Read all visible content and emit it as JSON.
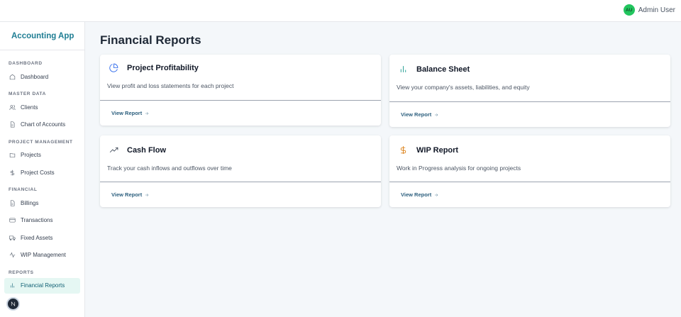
{
  "topbar": {
    "user_initials": "AU",
    "user_name": "Admin User"
  },
  "sidebar": {
    "brand": "Accounting App",
    "sections": [
      {
        "title": "DASHBOARD",
        "items": [
          {
            "label": "Dashboard",
            "icon": "home-icon"
          }
        ]
      },
      {
        "title": "MASTER DATA",
        "items": [
          {
            "label": "Clients",
            "icon": "users-icon"
          },
          {
            "label": "Chart of Accounts",
            "icon": "file-icon"
          }
        ]
      },
      {
        "title": "PROJECT MANAGEMENT",
        "items": [
          {
            "label": "Projects",
            "icon": "folder-icon"
          },
          {
            "label": "Project Costs",
            "icon": "dollar-icon"
          }
        ]
      },
      {
        "title": "FINANCIAL",
        "items": [
          {
            "label": "Billings",
            "icon": "file-icon"
          },
          {
            "label": "Transactions",
            "icon": "credit-card-icon"
          },
          {
            "label": "Fixed Assets",
            "icon": "truck-icon"
          },
          {
            "label": "WIP Management",
            "icon": "activity-icon"
          }
        ]
      },
      {
        "title": "REPORTS",
        "items": [
          {
            "label": "Financial Reports",
            "icon": "bar-chart-icon",
            "active": true
          }
        ]
      }
    ]
  },
  "main": {
    "title": "Financial Reports",
    "cards": [
      {
        "title": "Project Profitability",
        "description": "View profit and loss statements for each project",
        "link": "View Report",
        "icon": "pie-chart-icon",
        "icon_color": "#2563eb"
      },
      {
        "title": "Balance Sheet",
        "description": "View your company's assets, liabilities, and equity",
        "link": "View Report",
        "icon": "bar-chart-icon",
        "icon_color": "#0d9488"
      },
      {
        "title": "Cash Flow",
        "description": "Track your cash inflows and outflows over time",
        "link": "View Report",
        "icon": "trending-up-icon",
        "icon_color": "#374151"
      },
      {
        "title": "WIP Report",
        "description": "Work in Progress analysis for ongoing projects",
        "link": "View Report",
        "icon": "dollar-icon",
        "icon_color": "#d97706"
      }
    ]
  }
}
